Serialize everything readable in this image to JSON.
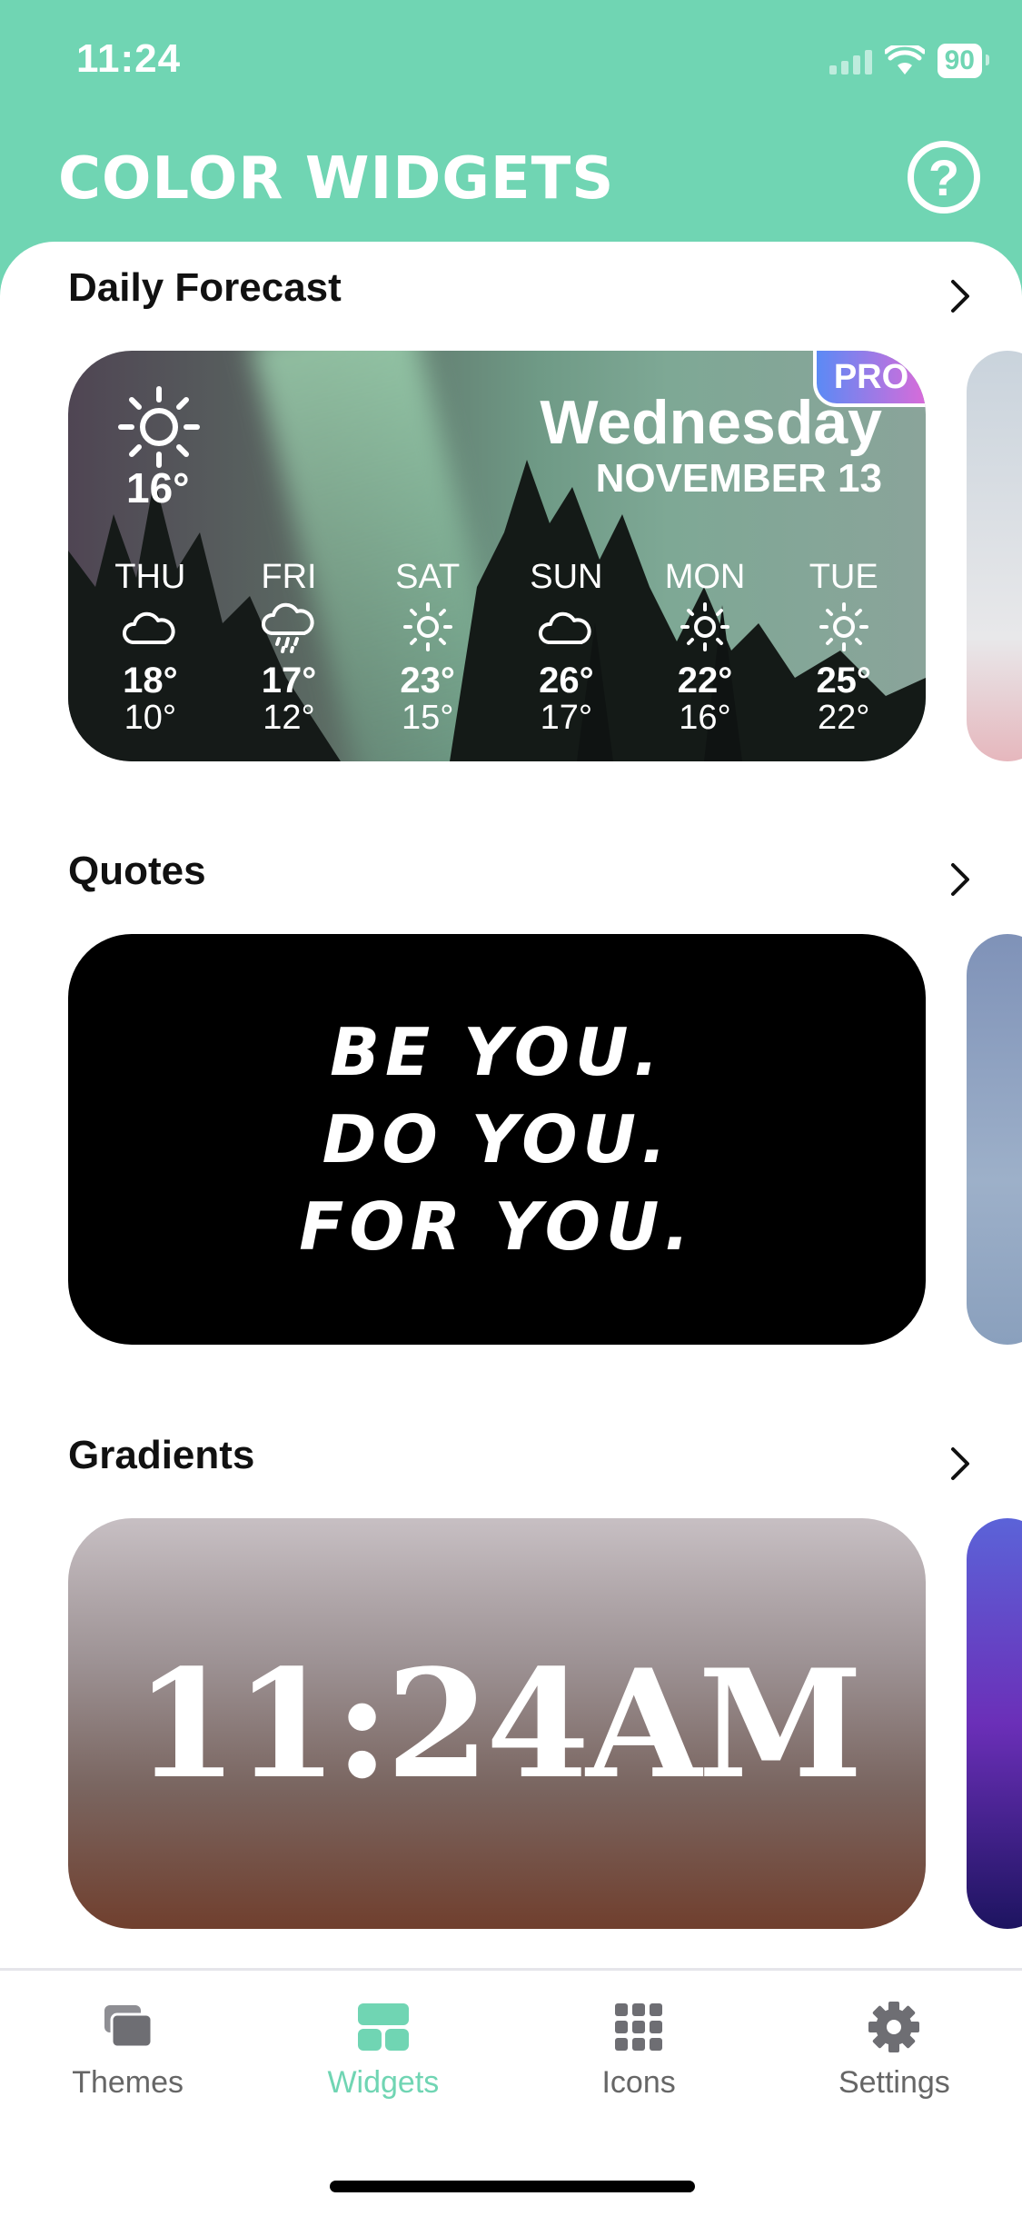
{
  "status_bar": {
    "time": "11:24",
    "battery": "90"
  },
  "header": {
    "title": "COLOR WIDGETS",
    "help_label": "?"
  },
  "sections": {
    "forecast": {
      "title": "Daily Forecast"
    },
    "quotes": {
      "title": "Quotes"
    },
    "gradients": {
      "title": "Gradients"
    }
  },
  "weather": {
    "pro_badge": "PRO",
    "day": "Wednesday",
    "date": "NOVEMBER 13",
    "current_temp": "16°",
    "current_icon": "sun-icon",
    "forecast": [
      {
        "day": "THU",
        "icon": "cloud-icon",
        "hi": "18°",
        "lo": "10°"
      },
      {
        "day": "FRI",
        "icon": "rain-icon",
        "hi": "17°",
        "lo": "12°"
      },
      {
        "day": "SAT",
        "icon": "sun-icon",
        "hi": "23°",
        "lo": "15°"
      },
      {
        "day": "SUN",
        "icon": "cloud-icon",
        "hi": "26°",
        "lo": "17°"
      },
      {
        "day": "MON",
        "icon": "sun-icon",
        "hi": "22°",
        "lo": "16°"
      },
      {
        "day": "TUE",
        "icon": "sun-icon",
        "hi": "25°",
        "lo": "22°"
      }
    ]
  },
  "quote": {
    "lines": [
      "BE YOU.",
      "DO YOU.",
      "FOR YOU."
    ]
  },
  "gradient_widget": {
    "time": "11:24AM"
  },
  "tab_bar": {
    "tabs": [
      {
        "label": "Themes",
        "icon": "themes-icon",
        "active": false
      },
      {
        "label": "Widgets",
        "icon": "widgets-icon",
        "active": true
      },
      {
        "label": "Icons",
        "icon": "icons-grid-icon",
        "active": false
      },
      {
        "label": "Settings",
        "icon": "gear-icon",
        "active": false
      }
    ]
  },
  "colors": {
    "brand": "#70d5b3",
    "text": "#111111",
    "inactive_tab": "#666666"
  }
}
